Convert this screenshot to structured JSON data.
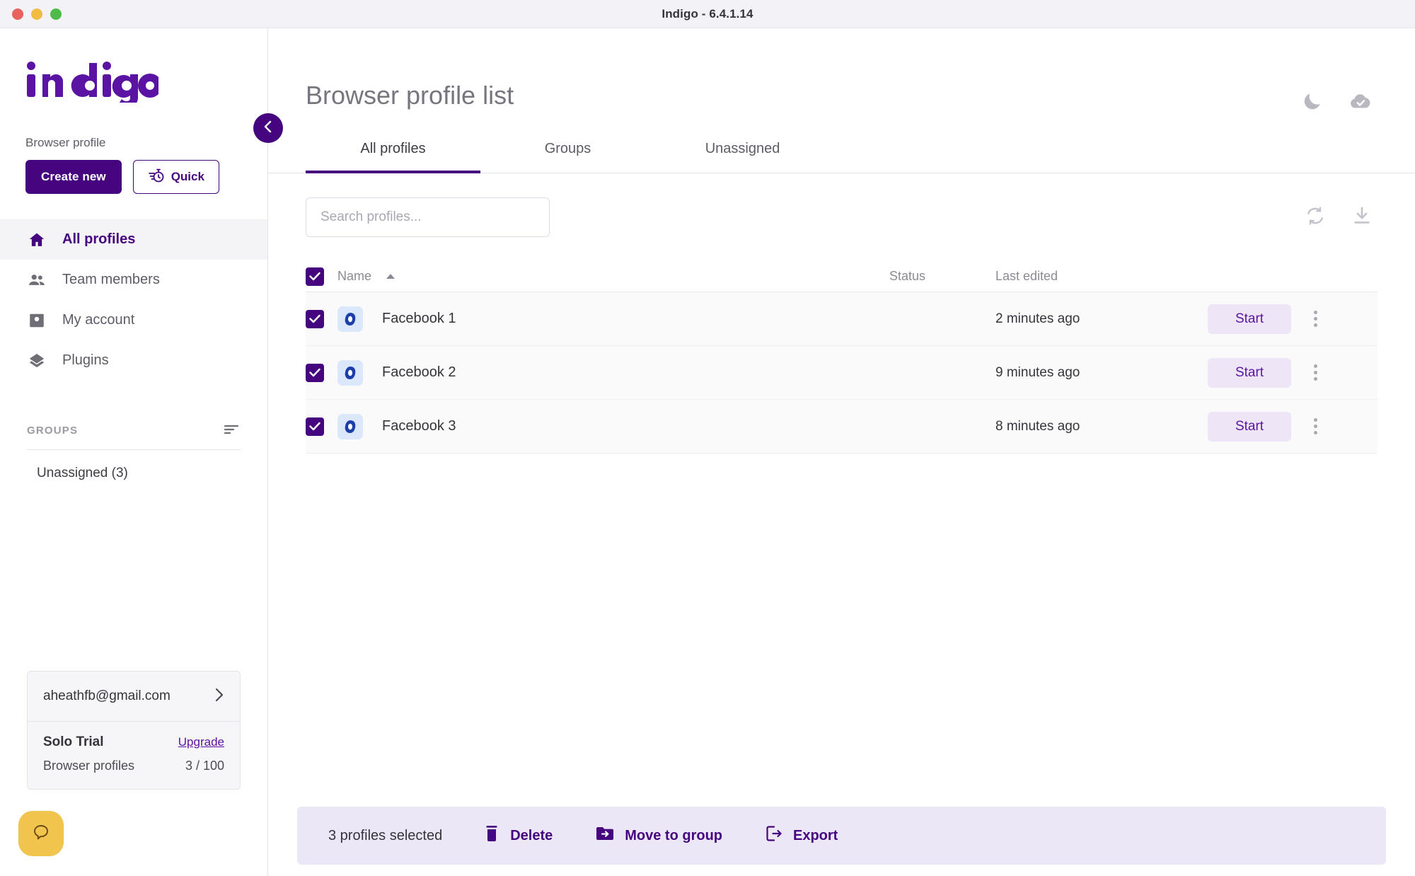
{
  "window": {
    "title": "Indigo - 6.4.1.14",
    "controls": [
      "close-dot",
      "minimize-dot",
      "zoom-dot"
    ]
  },
  "sidebar": {
    "logo_text": "indigo",
    "browser_profile_label": "Browser profile",
    "create_new_label": "Create new",
    "quick_label": "Quick",
    "quick_icon": "stopwatch-icon",
    "nav": [
      {
        "label": "All profiles",
        "icon": "home-icon",
        "active": true
      },
      {
        "label": "Team members",
        "icon": "people-icon",
        "active": false
      },
      {
        "label": "My account",
        "icon": "account-box-icon",
        "active": false
      },
      {
        "label": "Plugins",
        "icon": "layers-icon",
        "active": false
      }
    ],
    "groups_title": "GROUPS",
    "groups_sort_icon": "sort-icon",
    "groups": [
      {
        "label": "Unassigned",
        "count": "(3)"
      }
    ],
    "account": {
      "email": "aheathfb@gmail.com",
      "chevron_icon": "chevron-right-icon",
      "plan": "Solo Trial",
      "upgrade_label": "Upgrade",
      "quota_label": "Browser profiles",
      "quota_value": "3 / 100"
    },
    "chat_icon": "chat-bubble-icon",
    "collapse_icon": "chevron-left-icon"
  },
  "main": {
    "page_title": "Browser profile list",
    "header_icons": [
      {
        "name": "dark-mode-moon-icon"
      },
      {
        "name": "cloud-synced-icon"
      }
    ],
    "tabs": [
      {
        "label": "All profiles",
        "active": true
      },
      {
        "label": "Groups",
        "active": false
      },
      {
        "label": "Unassigned",
        "active": false
      }
    ],
    "search": {
      "value": "",
      "placeholder": "Search profiles..."
    },
    "toolbar_icons": [
      {
        "name": "refresh-icon"
      },
      {
        "name": "import-download-icon"
      }
    ],
    "table": {
      "columns": {
        "name": "Name",
        "status": "Status",
        "last_edited": "Last edited"
      },
      "sort": {
        "column": "Name",
        "direction": "asc"
      },
      "select_all_checked": true,
      "rows": [
        {
          "checked": true,
          "browser_icon": "edge-browser-icon",
          "name": "Facebook 1",
          "status": "",
          "last_edited": "2 minutes ago",
          "start_label": "Start",
          "menu_icon": "kebab-menu-icon"
        },
        {
          "checked": true,
          "browser_icon": "edge-browser-icon",
          "name": "Facebook 2",
          "status": "",
          "last_edited": "9 minutes ago",
          "start_label": "Start",
          "menu_icon": "kebab-menu-icon"
        },
        {
          "checked": true,
          "browser_icon": "edge-browser-icon",
          "name": "Facebook 3",
          "status": "",
          "last_edited": "8 minutes ago",
          "start_label": "Start",
          "menu_icon": "kebab-menu-icon"
        }
      ]
    },
    "action_bar": {
      "selected_text": "3 profiles selected",
      "actions": [
        {
          "label": "Delete",
          "icon": "trash-icon"
        },
        {
          "label": "Move to group",
          "icon": "folder-move-icon"
        },
        {
          "label": "Export",
          "icon": "export-icon"
        }
      ]
    }
  },
  "colors": {
    "brand_purple": "#45057f",
    "accent_purple": "#5b13a3",
    "start_button_bg": "#eee6f6",
    "action_bar_bg": "#ece7f6",
    "row_bg": "#fafafb",
    "chat_yellow": "#f1c44e"
  }
}
